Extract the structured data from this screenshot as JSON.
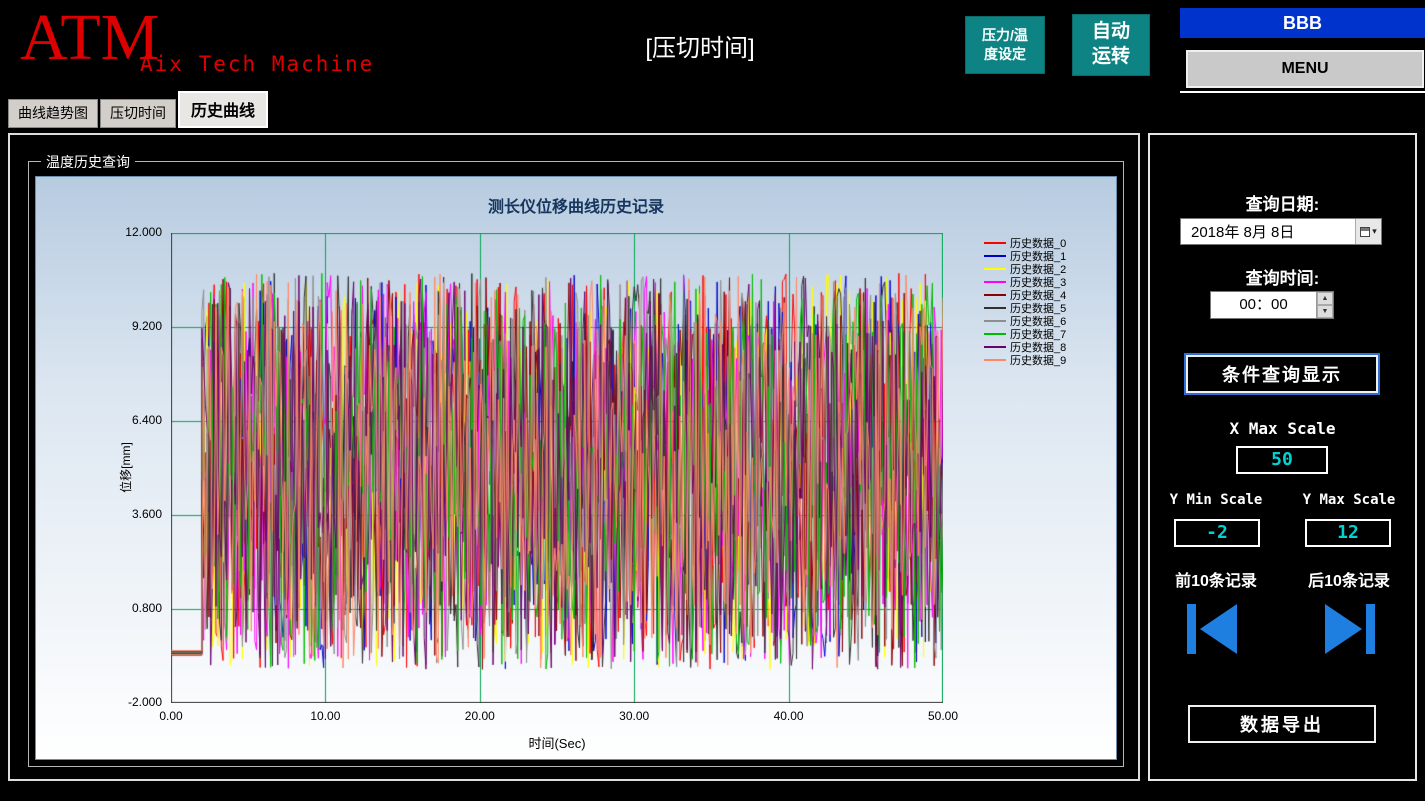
{
  "header": {
    "logo": "ATM",
    "logo_sub": "Aix Tech Machine",
    "title": "[压切时间]",
    "pressure_temp_line1": "压力/温",
    "pressure_temp_line2": "度设定",
    "auto_line1": "自动",
    "auto_line2": "运转",
    "bbb_label": "BBB",
    "menu_label": "MENU"
  },
  "tabs": [
    {
      "label": "曲线趋势图"
    },
    {
      "label": "压切时间"
    },
    {
      "label": "历史曲线"
    }
  ],
  "group_title": "温度历史查询",
  "chart_data": {
    "type": "line",
    "title": "测长仪位移曲线历史记录",
    "xlabel": "时间(Sec)",
    "ylabel": "位移[mm]",
    "xlim": [
      0,
      50
    ],
    "ylim": [
      -2,
      12
    ],
    "x_ticks": [
      "0.00",
      "10.00",
      "20.00",
      "30.00",
      "40.00",
      "50.00"
    ],
    "y_ticks": [
      "12.000",
      "9.200",
      "6.400",
      "3.600",
      "0.800",
      "-2.000"
    ],
    "grid": true,
    "grid_color": "#00a651",
    "legend_position": "right",
    "series": [
      {
        "name": "历史数据_0",
        "color": "#ff0000"
      },
      {
        "name": "历史数据_1",
        "color": "#0000cc"
      },
      {
        "name": "历史数据_2",
        "color": "#ffff00"
      },
      {
        "name": "历史数据_3",
        "color": "#ff00ff"
      },
      {
        "name": "历史数据_4",
        "color": "#8b0000"
      },
      {
        "name": "历史数据_5",
        "color": "#303030"
      },
      {
        "name": "历史数据_6",
        "color": "#8e8e8e"
      },
      {
        "name": "历史数据_7",
        "color": "#00bb00"
      },
      {
        "name": "历史数据_8",
        "color": "#6a006a"
      },
      {
        "name": "历史数据_9",
        "color": "#ff8866"
      }
    ],
    "noise_model": {
      "description": "each series is dense random oscillation between y_min and y_max starting after a flat lead-in segment",
      "x_flat_until": 2.0,
      "flat_value": -0.5,
      "x_end": 50,
      "y_min": -1.0,
      "y_max": 10.8,
      "points_per_series": 420,
      "seed": 20180808
    }
  },
  "sidebar": {
    "query_date_label": "查询日期:",
    "date_value": "2018年 8月 8日",
    "query_time_label": "查询时间:",
    "time_value": "00：00",
    "query_button_label": "条件查询显示",
    "x_max_label": "X Max Scale",
    "x_max_value": "50",
    "y_min_label": "Y Min Scale",
    "y_min_value": "-2",
    "y_max_label": "Y Max Scale",
    "y_max_value": "12",
    "prev_records_label": "前10条记录",
    "next_records_label": "后10条记录",
    "export_button_label": "数据导出",
    "value_text_color": "#00d2d2",
    "arrow_color": "#1f7fe0"
  }
}
